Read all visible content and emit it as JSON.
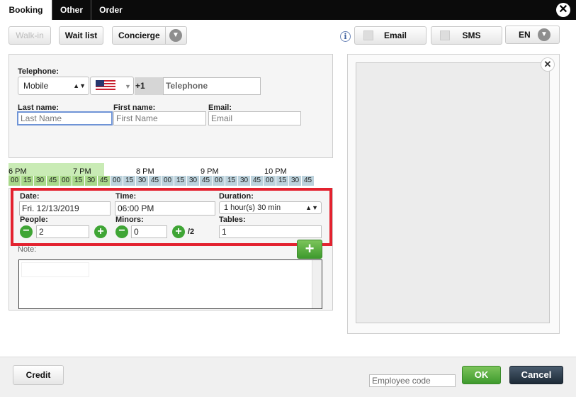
{
  "tabs": [
    "Booking",
    "Other",
    "Order"
  ],
  "toolbar": {
    "walkin": "Walk-in",
    "waitlist": "Wait list",
    "concierge": "Concierge",
    "email": "Email",
    "sms": "SMS",
    "lang": "EN"
  },
  "contact": {
    "telephone_label": "Telephone:",
    "phone_type": "Mobile",
    "country_code": "+1",
    "telephone_placeholder": "Telephone",
    "lastname_label": "Last name:",
    "firstname_label": "First name:",
    "email_label": "Email:",
    "lastname_placeholder": "Last Name",
    "firstname_placeholder": "First Name",
    "email_placeholder": "Email"
  },
  "timeline": {
    "hours": [
      "6 PM",
      "7 PM",
      "8 PM",
      "9 PM",
      "10 PM"
    ],
    "slots": [
      "00",
      "15",
      "30",
      "45",
      "00",
      "15",
      "30",
      "45",
      "00",
      "15",
      "30",
      "45",
      "00",
      "15",
      "30",
      "45",
      "00",
      "15",
      "30",
      "45",
      "00",
      "15",
      "30",
      "45"
    ],
    "available_slots": 8
  },
  "booking": {
    "date_label": "Date:",
    "date_value": "Fri. 12/13/2019",
    "time_label": "Time:",
    "time_value": "06:00 PM",
    "duration_label": "Duration:",
    "duration_value": "1 hour(s) 30 min",
    "people_label": "People:",
    "people_value": "2",
    "minors_label": "Minors:",
    "minors_value": "0",
    "minors_suffix": "/2",
    "tables_label": "Tables:",
    "tables_value": "1",
    "note_label": "Note:"
  },
  "footer": {
    "credit": "Credit",
    "employee_placeholder": "Employee code",
    "ok": "OK",
    "cancel": "Cancel"
  },
  "colors": {
    "accent_red": "#e3222f",
    "green": "#3fa535",
    "timeline_available": "#a8d88a",
    "timeline_booked": "#bcd2dc"
  }
}
